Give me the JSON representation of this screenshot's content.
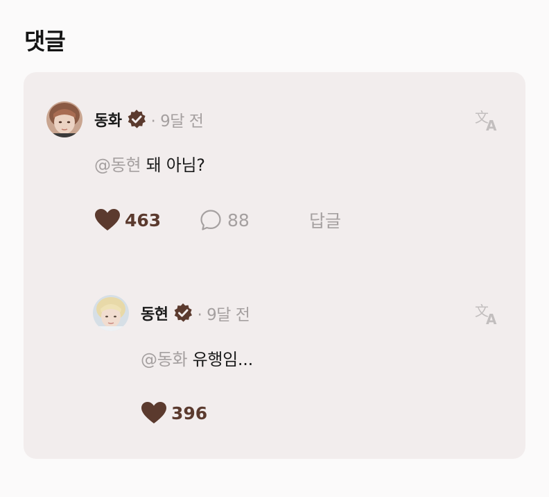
{
  "section": {
    "title": "댓글"
  },
  "comment": {
    "author": "동화",
    "time": "· 9달 전",
    "mention": "@동현",
    "text": " 돼 아님?",
    "likes": "463",
    "replies": "88",
    "reply_label": "답글"
  },
  "reply": {
    "author": "동현",
    "time": "· 9달 전",
    "mention": "@동화",
    "text": " 유행임...",
    "likes": "396"
  },
  "icons": {
    "verified": "verified-badge-icon",
    "translate": "translate-icon",
    "heart": "heart-icon",
    "comment": "comment-bubble-icon"
  },
  "colors": {
    "accent": "#5b3a2e",
    "muted": "#a5a0a0",
    "card_bg": "#f2eded",
    "page_bg": "#fbfafa"
  }
}
